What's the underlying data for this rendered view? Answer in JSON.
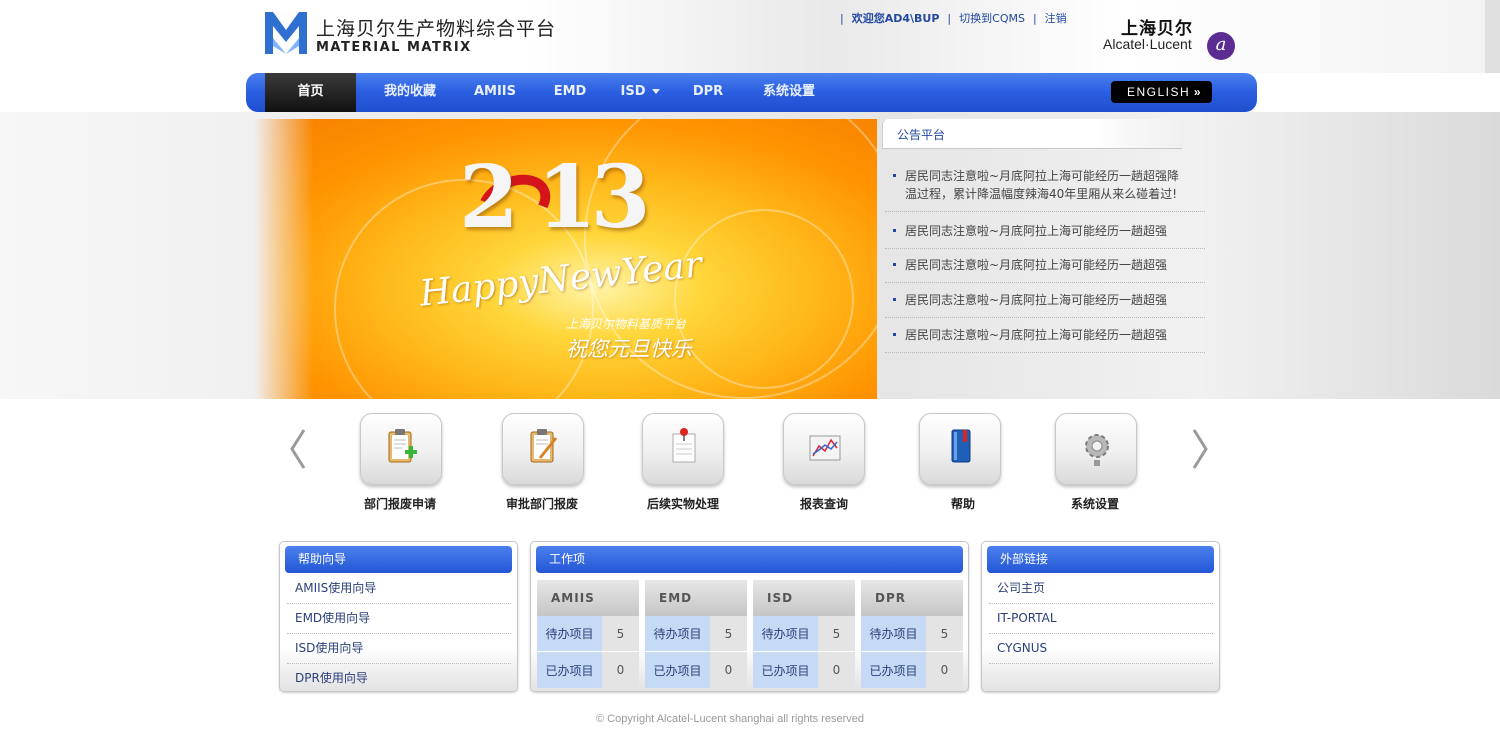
{
  "brand": {
    "name_cn": "上海贝尔生产物料综合平台",
    "name_en": "MATERIAL MATRIX",
    "partner_cn": "上海贝尔",
    "partner_en": "Alcatel·Lucent",
    "partner_mark": "a"
  },
  "top_links": {
    "welcome": "欢迎您AD4\\BUP",
    "switch": "切换到CQMS",
    "logout": "注销",
    "separator": "|"
  },
  "nav": {
    "items": [
      {
        "label": "首页",
        "active": true
      },
      {
        "label": "我的收藏"
      },
      {
        "label": "AMIIS"
      },
      {
        "label": "EMD"
      },
      {
        "label": "ISD",
        "dropdown": true
      },
      {
        "label": "DPR"
      },
      {
        "label": "系统设置"
      }
    ],
    "english": "ENGLISH",
    "english_arrow": "»"
  },
  "banner": {
    "year": "2013",
    "year_display": "2 13",
    "greeting": "HappyNewYear",
    "line1": "上海贝尔物料基质平台",
    "line2": "祝您元旦快乐"
  },
  "notice": {
    "title": "公告平台",
    "items": [
      "居民同志注意啦~月底阿拉上海可能经历一趟超强降温过程，累计降温幅度辣海40年里厢从来么碰着过!",
      "居民同志注意啦~月底阿拉上海可能经历一趟超强",
      "居民同志注意啦~月底阿拉上海可能经历一趟超强",
      "居民同志注意啦~月底阿拉上海可能经历一趟超强",
      "居民同志注意啦~月底阿拉上海可能经历一趟超强"
    ]
  },
  "shortcuts": {
    "prev_icon": "chevron-left-icon",
    "next_icon": "chevron-right-icon",
    "items": [
      {
        "label": "部门报废申请",
        "icon": "clipboard-add-icon"
      },
      {
        "label": "审批部门报废",
        "icon": "clipboard-edit-icon"
      },
      {
        "label": "后续实物处理",
        "icon": "pinned-note-icon"
      },
      {
        "label": "报表查询",
        "icon": "chart-icon"
      },
      {
        "label": "帮助",
        "icon": "book-icon"
      },
      {
        "label": "系统设置",
        "icon": "gear-icon"
      }
    ]
  },
  "help": {
    "title": "帮助向导",
    "links": [
      "AMIIS使用向导",
      "EMD使用向导",
      "ISD使用向导",
      "DPR使用向导"
    ]
  },
  "work": {
    "title": "工作项",
    "columns": [
      "AMIIS",
      "EMD",
      "ISD",
      "DPR"
    ],
    "todo_label": "待办项目",
    "done_label": "已办项目",
    "todo": [
      "5",
      "5",
      "5",
      "5"
    ],
    "done": [
      "0",
      "0",
      "0",
      "0"
    ]
  },
  "external": {
    "title": "外部链接",
    "links": [
      "公司主页",
      "IT-PORTAL",
      "CYGNUS"
    ]
  },
  "footer": {
    "copyright": "© Copyright Alcatel-Lucent shanghai all rights reserved"
  },
  "colors": {
    "nav_blue": "#2a5ee0",
    "link_blue": "#2248a0",
    "cell_blue": "#c7daf5",
    "banner_orange": "#ff9300"
  }
}
